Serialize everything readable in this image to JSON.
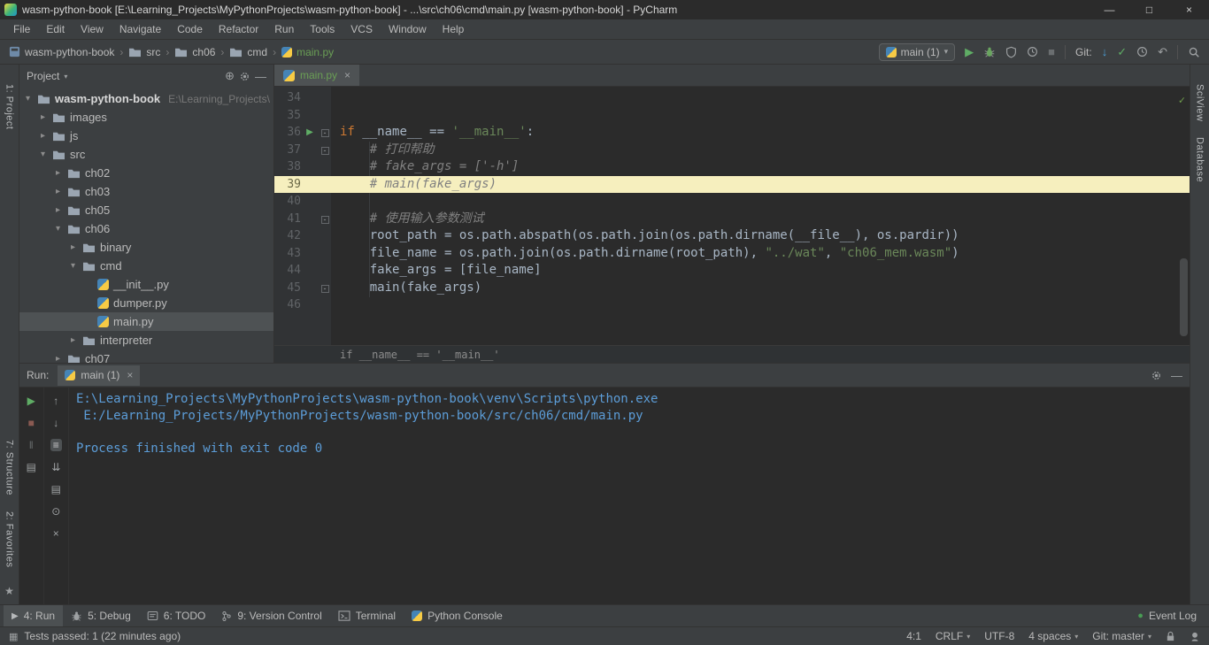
{
  "icons": {
    "rerun": "▶",
    "stop": "■",
    "pause": "‖",
    "restore-layout": "▤",
    "up": "↑",
    "down": "↓",
    "soft-wrap": "≡",
    "scroll-end": "⇊",
    "print": "▤",
    "pin": "⊙",
    "clear": "×",
    "run": "▶",
    "event-log-dot": "●",
    "tool-switcher": "▦",
    "chevron-expanded": "▾",
    "chevron-collapsed": "▸",
    "breadcrumb-sep": "›",
    "minimize": "—",
    "maximize": "□",
    "close": "×",
    "locate": "⊕",
    "hide": "—",
    "update": "↓",
    "commit": "✓",
    "rollback": "↶",
    "inspection-ok": "✓"
  },
  "colors": {
    "accent_green": "#499c54",
    "file_added": "#6a9f55",
    "console_text": "#5c9dd8",
    "highlight_line": "#f6efbe"
  },
  "title_bar": {
    "title": "wasm-python-book [E:\\Learning_Projects\\MyPythonProjects\\wasm-python-book] - ...\\src\\ch06\\cmd\\main.py [wasm-python-book] - PyCharm"
  },
  "menu_bar": {
    "items": [
      "File",
      "Edit",
      "View",
      "Navigate",
      "Code",
      "Refactor",
      "Run",
      "Tools",
      "VCS",
      "Window",
      "Help"
    ]
  },
  "toolbar": {
    "breadcrumbs": [
      {
        "label": "wasm-python-book",
        "icon": "project"
      },
      {
        "label": "src",
        "icon": "folder"
      },
      {
        "label": "ch06",
        "icon": "folder"
      },
      {
        "label": "cmd",
        "icon": "folder"
      },
      {
        "label": "main.py",
        "icon": "python",
        "green": true
      }
    ],
    "run_config": "main (1)",
    "git_label": "Git:"
  },
  "left_stripe": {
    "top": [
      "1: Project"
    ],
    "bottom": [
      "7: Structure",
      "2: Favorites"
    ]
  },
  "right_stripe": {
    "items": [
      "SciView",
      "Database"
    ]
  },
  "project": {
    "header": "Project",
    "tree": [
      {
        "label": "wasm-python-book",
        "path_hint": "E:\\Learning_Projects\\",
        "depth": 0,
        "icon": "folder",
        "chevron": "expanded",
        "bold": true
      },
      {
        "label": "images",
        "depth": 1,
        "icon": "folder",
        "chevron": "collapsed"
      },
      {
        "label": "js",
        "depth": 1,
        "icon": "folder",
        "chevron": "collapsed"
      },
      {
        "label": "src",
        "depth": 1,
        "icon": "folder",
        "chevron": "expanded"
      },
      {
        "label": "ch02",
        "depth": 2,
        "icon": "folder",
        "chevron": "collapsed"
      },
      {
        "label": "ch03",
        "depth": 2,
        "icon": "folder",
        "chevron": "collapsed"
      },
      {
        "label": "ch05",
        "depth": 2,
        "icon": "folder",
        "chevron": "collapsed"
      },
      {
        "label": "ch06",
        "depth": 2,
        "icon": "folder",
        "chevron": "expanded"
      },
      {
        "label": "binary",
        "depth": 3,
        "icon": "folder",
        "chevron": "collapsed"
      },
      {
        "label": "cmd",
        "depth": 3,
        "icon": "folder",
        "chevron": "expanded"
      },
      {
        "label": "__init__.py",
        "depth": 4,
        "icon": "python",
        "chevron": "none"
      },
      {
        "label": "dumper.py",
        "depth": 4,
        "icon": "python",
        "chevron": "none"
      },
      {
        "label": "main.py",
        "depth": 4,
        "icon": "python",
        "chevron": "none",
        "selected": true
      },
      {
        "label": "interpreter",
        "depth": 3,
        "icon": "folder",
        "chevron": "collapsed"
      },
      {
        "label": "ch07",
        "depth": 2,
        "icon": "folder",
        "chevron": "collapsed"
      }
    ]
  },
  "editor": {
    "tab": {
      "label": "main.py"
    },
    "context_line": "if __name__ == '__main__'",
    "lines": [
      {
        "n": 34,
        "segs": []
      },
      {
        "n": 35,
        "segs": []
      },
      {
        "n": 36,
        "gutter": "run",
        "fold": true,
        "segs": [
          {
            "t": "if ",
            "c": "kw"
          },
          {
            "t": "__name__ == ",
            "c": "plain"
          },
          {
            "t": "'__main__'",
            "c": "str"
          },
          {
            "t": ":",
            "c": "plain"
          }
        ]
      },
      {
        "n": 37,
        "fold": true,
        "segs": [
          {
            "t": "    # 打印帮助",
            "c": "cmt"
          }
        ]
      },
      {
        "n": 38,
        "segs": [
          {
            "t": "    # fake_args = ['-h']",
            "c": "cmt"
          }
        ]
      },
      {
        "n": 39,
        "highlight": true,
        "segs": [
          {
            "t": "    # main(fake_args)",
            "c": "cmt"
          }
        ]
      },
      {
        "n": 40,
        "segs": []
      },
      {
        "n": 41,
        "fold": true,
        "segs": [
          {
            "t": "    # 使用输入参数测试",
            "c": "cmt"
          }
        ]
      },
      {
        "n": 42,
        "segs": [
          {
            "t": "    root_path = os.path.abspath(os.path.join(os.path.dirname(__file__), os.pardir))",
            "c": "plain"
          }
        ]
      },
      {
        "n": 43,
        "segs": [
          {
            "t": "    file_name = os.path.join(os.path.dirname(root_path), ",
            "c": "plain"
          },
          {
            "t": "\"../wat\"",
            "c": "str"
          },
          {
            "t": ", ",
            "c": "plain"
          },
          {
            "t": "\"ch06_mem.wasm\"",
            "c": "str"
          },
          {
            "t": ")",
            "c": "plain"
          }
        ]
      },
      {
        "n": 44,
        "segs": [
          {
            "t": "    fake_args = [file_name]",
            "c": "plain"
          }
        ]
      },
      {
        "n": 45,
        "fold": true,
        "segs": [
          {
            "t": "    main(fake_args)",
            "c": "plain"
          }
        ]
      },
      {
        "n": 46,
        "segs": []
      }
    ]
  },
  "run_panel": {
    "label": "Run:",
    "tab": "main (1)",
    "toolbar_main": [
      {
        "name": "rerun",
        "style": "green"
      },
      {
        "name": "stop",
        "style": "dim-red"
      },
      {
        "name": "pause",
        "style": "dim"
      },
      {
        "name": "restore-layout",
        "style": ""
      }
    ],
    "toolbar_side": [
      {
        "name": "up"
      },
      {
        "name": "down"
      },
      {
        "name": "soft-wrap",
        "style": "active"
      },
      {
        "name": "scroll-end"
      },
      {
        "name": "print"
      },
      {
        "name": "pin"
      },
      {
        "name": "clear"
      }
    ],
    "console_lines": [
      "E:\\Learning_Projects\\MyPythonProjects\\wasm-python-book\\venv\\Scripts\\python.exe",
      " E:/Learning_Projects/MyPythonProjects/wasm-python-book/src/ch06/cmd/main.py",
      "",
      "Process finished with exit code 0"
    ]
  },
  "bottom_bar": {
    "items": [
      {
        "label": "4: Run",
        "icon": "run",
        "active": true
      },
      {
        "label": "5: Debug",
        "icon": "bug"
      },
      {
        "label": "6: TODO",
        "icon": "todo"
      },
      {
        "label": "9: Version Control",
        "icon": "branch"
      },
      {
        "label": "Terminal",
        "icon": "terminal"
      },
      {
        "label": "Python Console",
        "icon": "python"
      }
    ],
    "right": {
      "label": "Event Log"
    }
  },
  "status_bar": {
    "left": "Tests passed: 1 (22 minutes ago)",
    "items": [
      {
        "label": "4:1"
      },
      {
        "label": "CRLF",
        "chevron": true
      },
      {
        "label": "UTF-8"
      },
      {
        "label": "4 spaces",
        "chevron": true
      },
      {
        "label": "Git: master",
        "chevron": true
      }
    ]
  }
}
